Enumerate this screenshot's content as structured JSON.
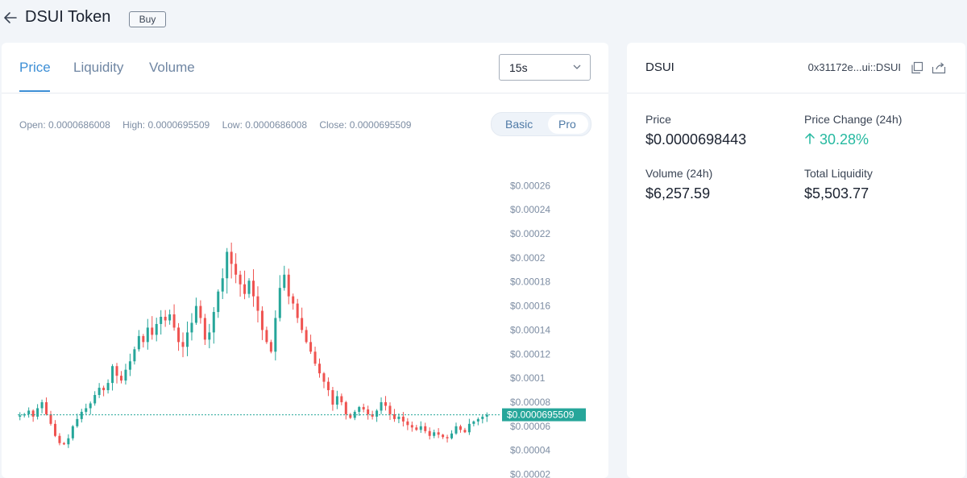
{
  "header": {
    "title": "DSUI Token",
    "buy_label": "Buy"
  },
  "tabs": [
    {
      "label": "Price",
      "active": true
    },
    {
      "label": "Liquidity",
      "active": false
    },
    {
      "label": "Volume",
      "active": false
    }
  ],
  "interval_select": {
    "value": "15s"
  },
  "ohlc": {
    "open": "Open: 0.0000686008",
    "high": "High: 0.0000695509",
    "low": "Low: 0.0000686008",
    "close": "Close: 0.0000695509"
  },
  "view_toggle": {
    "basic": "Basic",
    "pro": "Pro",
    "selected": "Pro"
  },
  "token_info": {
    "symbol": "DSUI",
    "address": "0x31172e...ui::DSUI",
    "price_label": "Price",
    "price_value": "$0.0000698443",
    "change_label": "Price Change (24h)",
    "change_value": "30.28%",
    "volume_label": "Volume (24h)",
    "volume_value": "$6,257.59",
    "liquidity_label": "Total Liquidity",
    "liquidity_value": "$5,503.77"
  },
  "colors": {
    "up": "#26a69a",
    "down": "#ef5350",
    "accent": "#3d8fd6",
    "price_label_bg": "#26a69a"
  },
  "chart_data": {
    "type": "candlestick",
    "current_price": 6.95509e-05,
    "current_price_label": "$0.0000695509",
    "y_ticks": [
      "$0.00026",
      "$0.00024",
      "$0.00022",
      "$0.0002",
      "$0.00018",
      "$0.00016",
      "$0.00014",
      "$0.00012",
      "$0.0001",
      "$0.00008",
      "$0.00006",
      "$0.00004",
      "$0.00002"
    ],
    "y_tick_values": [
      0.00026,
      0.00024,
      0.00022,
      0.0002,
      0.00018,
      0.00016,
      0.00014,
      0.00012,
      0.0001,
      8e-05,
      6e-05,
      4e-05,
      2e-05
    ],
    "ylim": [
      1.7e-05,
      0.000285
    ],
    "close_series": [
      6.9e-05,
      7e-05,
      7.3e-05,
      6.8e-05,
      7.5e-05,
      8e-05,
      7e-05,
      6.2e-05,
      5.2e-05,
      4.6e-05,
      4.5e-05,
      5e-05,
      6e-05,
      6.6e-05,
      7.2e-05,
      7.5e-05,
      7.9e-05,
      8.6e-05,
      9.2e-05,
      9e-05,
      9.6e-05,
      0.00011,
      0.000102,
      9.8e-05,
      0.000107,
      0.000114,
      0.000124,
      0.000135,
      0.00013,
      0.000142,
      0.000136,
      0.000145,
      0.000151,
      0.000148,
      0.000153,
      0.000142,
      0.00013,
      0.000126,
      0.000138,
      0.000146,
      0.00016,
      0.00015,
      0.000132,
      0.000138,
      0.000155,
      0.000172,
      0.000183,
      0.000205,
      0.000195,
      0.000186,
      0.000178,
      0.00017,
      0.000181,
      0.000168,
      0.000156,
      0.00014,
      0.00013,
      0.000122,
      0.00015,
      0.000175,
      0.000186,
      0.000168,
      0.000162,
      0.00015,
      0.00014,
      0.00013,
      0.000122,
      0.000112,
      0.000104,
      9.7e-05,
      9e-05,
      7.8e-05,
      8.5e-05,
      8e-05,
      7e-05,
      6.7e-05,
      7.2e-05,
      7.6e-05,
      7.4e-05,
      7e-05,
      6.8e-05,
      7.3e-05,
      8e-05,
      7.7e-05,
      7e-05,
      6.6e-05,
      6.8e-05,
      6.4e-05,
      6.1e-05,
      5.9e-05,
      5.7e-05,
      6e-05,
      5.6e-05,
      5.2e-05,
      5.5e-05,
      5.3e-05,
      5.1e-05,
      5e-05,
      5.4e-05,
      6e-05,
      5.7e-05,
      5.5e-05,
      6.2e-05,
      6.4e-05,
      6.6e-05,
      6.8e-05,
      6.95509e-05
    ]
  }
}
